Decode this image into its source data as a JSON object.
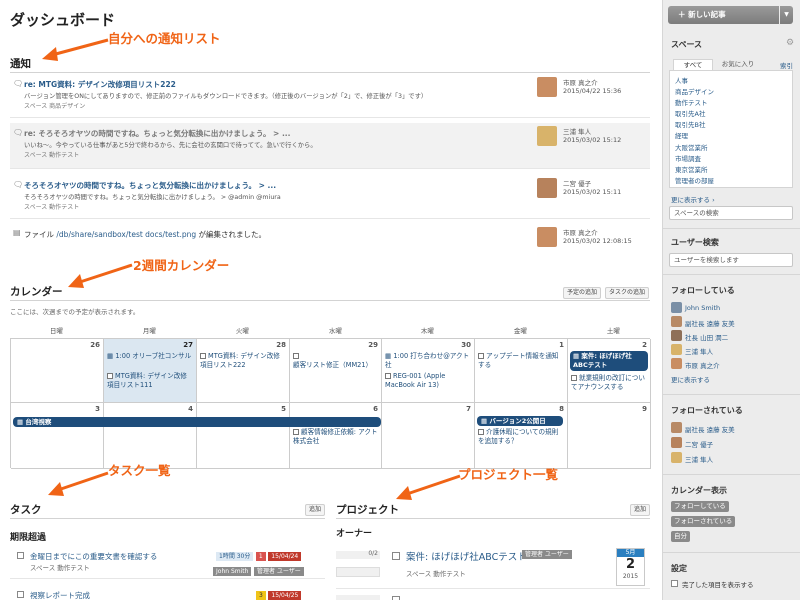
{
  "page_title": "ダッシュボード",
  "annotations": {
    "notifications": "自分への通知リスト",
    "calendar": "2週間カレンダー",
    "tasks": "タスク一覧",
    "projects": "プロジェクト一覧"
  },
  "notifications": {
    "title": "通知",
    "items": [
      {
        "title": "re: MTG資料: デザイン改修項目リスト222",
        "body": "バージョン管理をONにしてありますので、修正前のファイルもダウンロードできます。（修正後のバージョンが「2」で、修正後が「3」です）",
        "space": "スペース 商品デザイン",
        "user": "市原 真之介",
        "date": "2015/04/22 15:36",
        "icon": "comment-icon",
        "avatar_color": "#c98d62"
      },
      {
        "title": "re: そろそろオヤツの時間ですね。ちょっと気分転換に出かけましょう。 > ...",
        "body": "いいね〜。今やっている仕事があと5分で終わるから、先に会社の玄関口で待ってて。急いで行くから。",
        "space": "スペース 動作テスト",
        "user": "三浦 隼人",
        "date": "2015/03/02 15:12",
        "icon": "comment-icon",
        "avatar_color": "#d8b36a"
      },
      {
        "title": "そろそろオヤツの時間ですね。ちょっと気分転換に出かけましょう。 > ...",
        "body": "そろそろオヤツの時間ですね。ちょっと気分転換に出かけましょう。 > @admin @miura",
        "space": "スペース 動作テスト",
        "user": "二宮 優子",
        "date": "2015/03/02 15:11",
        "icon": "comment-icon",
        "avatar_color": "#b7825c"
      },
      {
        "title_prefix": "ファイル ",
        "title_link": "/db/share/sandbox/test docs/test.png",
        "title_suffix": " が編集されました。",
        "user": "市原 真之介",
        "date": "2015/03/02 12:08:15",
        "icon": "file-icon",
        "avatar_color": "#c98d62"
      }
    ]
  },
  "calendar": {
    "title": "カレンダー",
    "subtitle": "ここには、次週までの予定が表示されます。",
    "add_event_label": "予定の追加",
    "add_task_label": "タスクの追加",
    "weekdays": [
      "日曜",
      "月曜",
      "火曜",
      "水曜",
      "木曜",
      "金曜",
      "土曜"
    ],
    "week1_days": [
      "26",
      "27",
      "28",
      "29",
      "30",
      "1",
      "2"
    ],
    "week2_days": [
      "3",
      "4",
      "5",
      "6",
      "7",
      "8",
      "9"
    ],
    "events": {
      "w1_mon_1": "1:00 オリーブ社コンサル",
      "w1_mon_2": "MTG資料: デザイン改修項目リスト111",
      "w1_tue_1": "MTG資料: デザイン改修項目リスト222",
      "w1_wed_1": "顧客リスト修正（MM21）",
      "w1_thu_1": "1:00 打ち合わせ@アクト社",
      "w1_thu_2": "REG-001 (Apple MacBook Air 13)",
      "w1_fri_1": "アップデート情報を通知する",
      "w1_sat_bar": "案件: ほげほげ社ABCテスト",
      "w1_sat_1": "就業規則の改訂についてアナウンスする",
      "w2_bar": "台湾視察",
      "w2_wed_1": "顧客情報修正依頼: アクト株式会社",
      "w2_fri_bar": "バージョン2公開日",
      "w2_fri_1": "介護休暇についての規則を追加する？"
    }
  },
  "tasks": {
    "title": "タスク",
    "add_label": "追加",
    "group": "期限超過",
    "items": [
      {
        "title": "金曜日までにこの重要文書を確認する",
        "space": "スペース 動作テスト",
        "time": "1時間 30分",
        "priority": "1",
        "date": "15/04/24",
        "assignees": [
          "John Smith",
          "管理者 ユーザー"
        ]
      },
      {
        "title": "視察レポート完成",
        "time": "",
        "priority": "3",
        "date": "15/04/25",
        "assignees": []
      }
    ]
  },
  "projects": {
    "title": "プロジェクト",
    "add_label": "追加",
    "group": "オーナー",
    "items": [
      {
        "progress": "0/2",
        "title": "案件: ほげほげ社ABCテスト",
        "owner": "管理者 ユーザー",
        "space": "スペース 動作テスト",
        "month": "5月",
        "day": "2",
        "year": "2015"
      }
    ]
  },
  "sidebar": {
    "new_post": "新しい記事",
    "spaces_title": "スペース",
    "tab_all": "すべて",
    "tab_favorites": "お気に入り",
    "index_link": "索引",
    "spaces": [
      "人事",
      "商品デザイン",
      "動作テスト",
      "取引先A社",
      "取引先B社",
      "経理",
      "大阪営業所",
      "市場調査",
      "東京営業所",
      "管理者の部屋"
    ],
    "more_spaces": "更に表示する",
    "space_search_placeholder": "スペースの検索",
    "user_search_title": "ユーザー検索",
    "user_search_placeholder": "ユーザーを検索します",
    "following_title": "フォローしている",
    "following": [
      {
        "name": "John Smith",
        "color": "#7a8fa6"
      },
      {
        "name": "副社長 遠藤 友美",
        "color": "#b88a66"
      },
      {
        "name": "社長 山田 潤二",
        "color": "#8f7058"
      },
      {
        "name": "三浦 隼人",
        "color": "#d8b36a"
      },
      {
        "name": "市原 真之介",
        "color": "#c98d62"
      }
    ],
    "following_more": "更に表示する",
    "followers_title": "フォローされている",
    "followers": [
      {
        "name": "副社長 遠藤 友美",
        "color": "#b88a66"
      },
      {
        "name": "二宮 優子",
        "color": "#b7825c"
      },
      {
        "name": "三浦 隼人",
        "color": "#d8b36a"
      }
    ],
    "calendar_view_title": "カレンダー表示",
    "cal_btn_following": "フォローしている",
    "cal_btn_followers": "フォローされている",
    "cal_btn_self": "自分",
    "settings_title": "設定",
    "settings_show_done": "完了した項目を表示する"
  },
  "colors": {
    "accent": "#1e4d7b",
    "annotation": "#f06416",
    "today_bg": "#dbe7f1",
    "overdue_red": "#c0392b",
    "gray_tag": "#8a8a8a"
  }
}
